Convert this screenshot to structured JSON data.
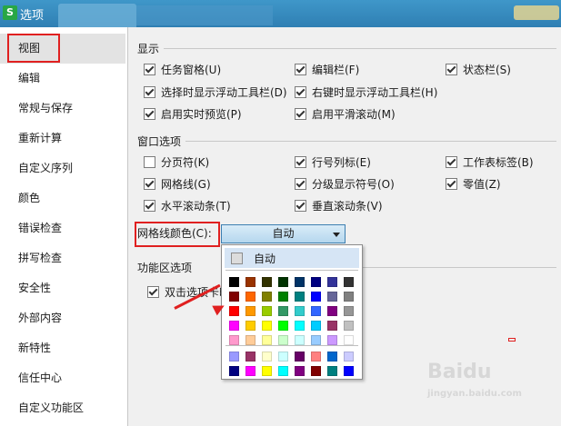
{
  "window": {
    "title": "选项",
    "app_icon_letter": "S"
  },
  "sidebar": {
    "items": [
      "视图",
      "编辑",
      "常规与保存",
      "重新计算",
      "自定义序列",
      "颜色",
      "错误检查",
      "拼写检查",
      "安全性",
      "外部内容",
      "新特性",
      "信任中心",
      "自定义功能区"
    ],
    "active_index": 0
  },
  "display": {
    "title": "显示",
    "options": [
      {
        "label": "任务窗格(U)",
        "checked": true
      },
      {
        "label": "编辑栏(F)",
        "checked": true
      },
      {
        "label": "状态栏(S)",
        "checked": true
      },
      {
        "label": "选择时显示浮动工具栏(D)",
        "checked": true
      },
      {
        "label": "右键时显示浮动工具栏(H)",
        "checked": true
      },
      {
        "label": "启用实时预览(P)",
        "checked": true
      },
      {
        "label": "启用平滑滚动(M)",
        "checked": true
      }
    ]
  },
  "window_options": {
    "title": "窗口选项",
    "options": [
      {
        "label": "分页符(K)",
        "checked": false
      },
      {
        "label": "行号列标(E)",
        "checked": true
      },
      {
        "label": "工作表标签(B)",
        "checked": true
      },
      {
        "label": "网格线(G)",
        "checked": true
      },
      {
        "label": "分级显示符号(O)",
        "checked": true
      },
      {
        "label": "零值(Z)",
        "checked": true
      },
      {
        "label": "水平滚动条(T)",
        "checked": true
      },
      {
        "label": "垂直滚动条(V)",
        "checked": true
      }
    ],
    "gridline_color_label": "网格线颜色(C):",
    "gridline_color_value": "自动"
  },
  "ribbon_options": {
    "title": "功能区选项",
    "options": [
      {
        "label": "双击选项卡时",
        "checked": true
      }
    ]
  },
  "color_popup": {
    "auto_label": "自动",
    "palette": [
      [
        "#000000",
        "#993300",
        "#333300",
        "#003300",
        "#003366",
        "#000080",
        "#333399",
        "#333333"
      ],
      [
        "#800000",
        "#FF6600",
        "#808000",
        "#008000",
        "#008080",
        "#0000FF",
        "#666699",
        "#808080"
      ],
      [
        "#FF0000",
        "#FF9900",
        "#99CC00",
        "#339966",
        "#33CCCC",
        "#3366FF",
        "#800080",
        "#969696"
      ],
      [
        "#FF00FF",
        "#FFCC00",
        "#FFFF00",
        "#00FF00",
        "#00FFFF",
        "#00CCFF",
        "#993366",
        "#C0C0C0"
      ],
      [
        "#FF99CC",
        "#FFCC99",
        "#FFFF99",
        "#CCFFCC",
        "#CCFFFF",
        "#99CCFF",
        "#CC99FF",
        "#FFFFFF"
      ]
    ],
    "custom": [
      [
        "#9999FF",
        "#993366",
        "#FFFFCC",
        "#CCFFFF",
        "#660066",
        "#FF8080",
        "#0066CC",
        "#CCCCFF"
      ],
      [
        "#000080",
        "#FF00FF",
        "#FFFF00",
        "#00FFFF",
        "#800080",
        "#800000",
        "#008080",
        "#0000FF"
      ]
    ]
  },
  "watermark": {
    "text": "Baidu",
    "sub": "jingyan.baidu.com"
  }
}
